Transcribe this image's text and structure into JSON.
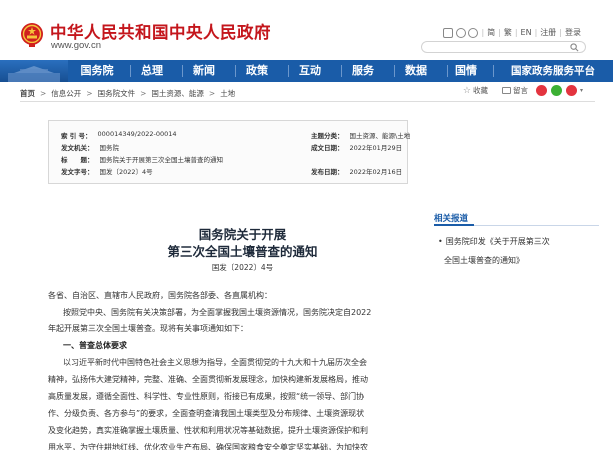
{
  "site": {
    "title": "中华人民共和国中央人民政府",
    "url": "www.gov.cn"
  },
  "top_links": [
    "简",
    "繁",
    "EN",
    "注册",
    "登录"
  ],
  "search": {
    "placeholder": ""
  },
  "nav": [
    "国务院",
    "总理",
    "新闻",
    "政策",
    "互动",
    "服务",
    "数据",
    "国情",
    "国家政务服务平台"
  ],
  "breadcrumb": [
    "首页",
    "信息公开",
    "国务院文件",
    "国土资源、能源",
    "土地"
  ],
  "tools": {
    "favorite": "收藏",
    "message": "留言"
  },
  "meta": {
    "index_label": "索 引 号：",
    "index_value": "000014349/2022-00014",
    "topic_label": "主题分类：",
    "topic_value": "国土资源、能源\\土地",
    "issuer_label": "发文机关：",
    "issuer_value": "国务院",
    "written_label": "成文日期：",
    "written_value": "2022年01月29日",
    "title_label": "标　　题：",
    "title_value": "国务院关于开展第三次全国土壤普查的通知",
    "docno_label": "发文字号：",
    "docno_value": "国发〔2022〕4号",
    "publish_label": "发布日期：",
    "publish_value": "2022年02月16日"
  },
  "sidebar": {
    "title": "相关报道",
    "link_line1": "国务院印发《关于开展第三次",
    "link_line2": "全国土壤普查的通知》"
  },
  "article": {
    "title_line1": "国务院关于开展",
    "title_line2": "第三次全国土壤普查的通知",
    "number": "国发〔2022〕4号",
    "salutation": "各省、自治区、直辖市人民政府，国务院各部委、各直属机构：",
    "p1_line1": "按照党中央、国务院有关决策部署，为全面掌握我国土壤资源情况，国务院决定自2022",
    "p1_line2": "年起开展第三次全国土壤普查。现将有关事项通知如下：",
    "section1": "一、普查总体要求",
    "p2_line1": "以习近平新时代中国特色社会主义思想为指导，全面贯彻党的十九大和十九届历次全会",
    "p2_line2": "精神，弘扬伟大建党精神，完整、准确、全面贯彻新发展理念，加快构建新发展格局，推动",
    "p2_line3": "高质量发展，遵循全面性、科学性、专业性原则，衔接已有成果，按照“统一领导、部门协",
    "p2_line4": "作、分级负责、各方参与”的要求，全面查明查清我国土壤类型及分布规律、土壤资源现状",
    "p2_line5": "及变化趋势，真实准确掌握土壤质量、性状和利用状况等基础数据，提升土壤资源保护和利",
    "p2_line6": "用水平，为守住耕地红线、优化农业生产布局、确保国家粮食安全奠定坚实基础，为加快农"
  },
  "colors": {
    "brand_red": "#c4161c",
    "nav_blue": "#1a5ca8"
  }
}
